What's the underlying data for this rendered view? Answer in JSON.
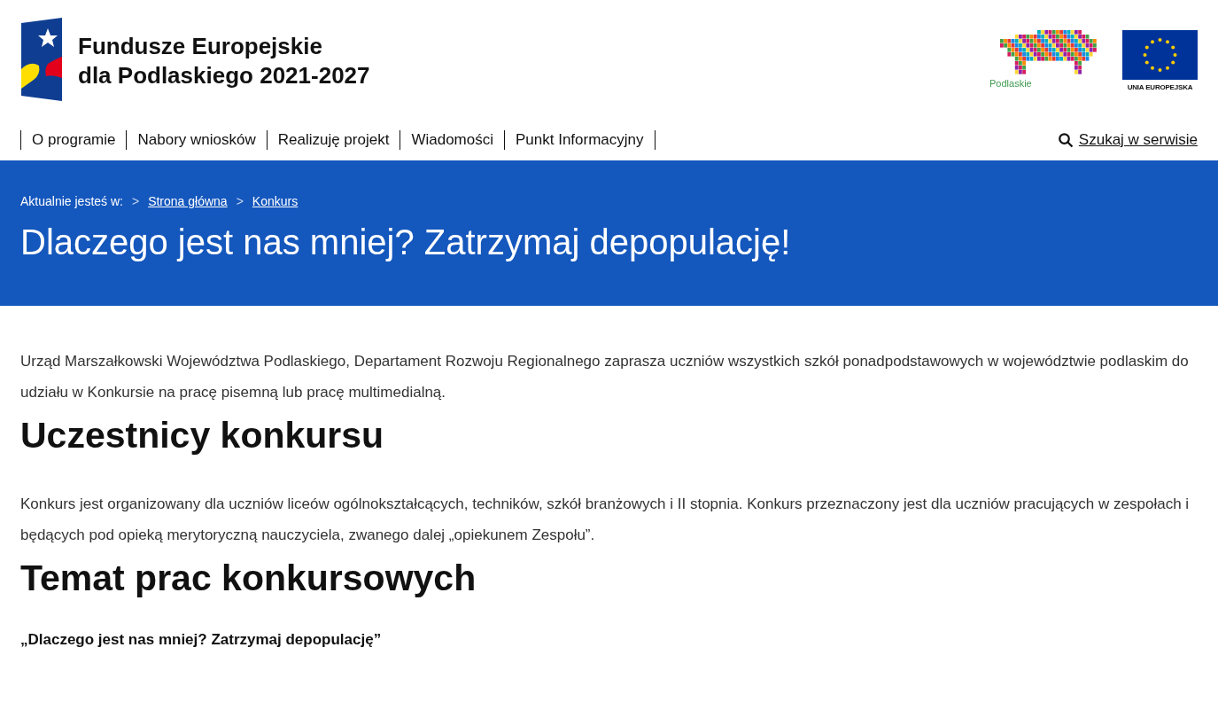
{
  "brand": {
    "title_line1": "Fundusze Europejskie",
    "title_line2": "dla Podlaskiego 2021-2027",
    "region_logo_text": "Podlaskie",
    "eu_logo_text": "UNIA EUROPEJSKA"
  },
  "nav": {
    "items": [
      {
        "label": "O programie"
      },
      {
        "label": "Nabory wniosków"
      },
      {
        "label": "Realizuję projekt"
      },
      {
        "label": "Wiadomości"
      },
      {
        "label": "Punkt Informacyjny"
      }
    ],
    "search_link": "Szukaj w serwisie"
  },
  "hero": {
    "breadcrumb_label": "Aktualnie jesteś w:",
    "breadcrumb": [
      {
        "separator": ">",
        "label": "Strona główna"
      },
      {
        "separator": ">",
        "label": "Konkurs"
      }
    ],
    "title": "Dlaczego jest nas mniej? Zatrzymaj depopulację!"
  },
  "content": [
    {
      "kind": "paragraph",
      "text": "Urząd Marszałkowski Województwa Podlaskiego, Departament Rozwoju Regionalnego zaprasza uczniów wszystkich szkół ponadpodstawowych w województwie podlaskim do udziału w Konkursie na pracę pisemną lub pracę multimedialną."
    },
    {
      "kind": "heading",
      "text": "Uczestnicy konkursu"
    },
    {
      "kind": "paragraph",
      "text": "Konkurs jest organizowany dla uczniów liceów ogólnokształcących, techników, szkół branżowych i II stopnia. Konkurs przeznaczony jest dla uczniów pracujących w zespołach i będących pod opieką merytoryczną nauczyciela, zwanego dalej „opiekunem Zespołu”."
    },
    {
      "kind": "heading",
      "text": "Temat prac konkursowych"
    },
    {
      "kind": "strong",
      "text": "„Dlaczego jest nas mniej? Zatrzymaj depopulację”"
    }
  ]
}
